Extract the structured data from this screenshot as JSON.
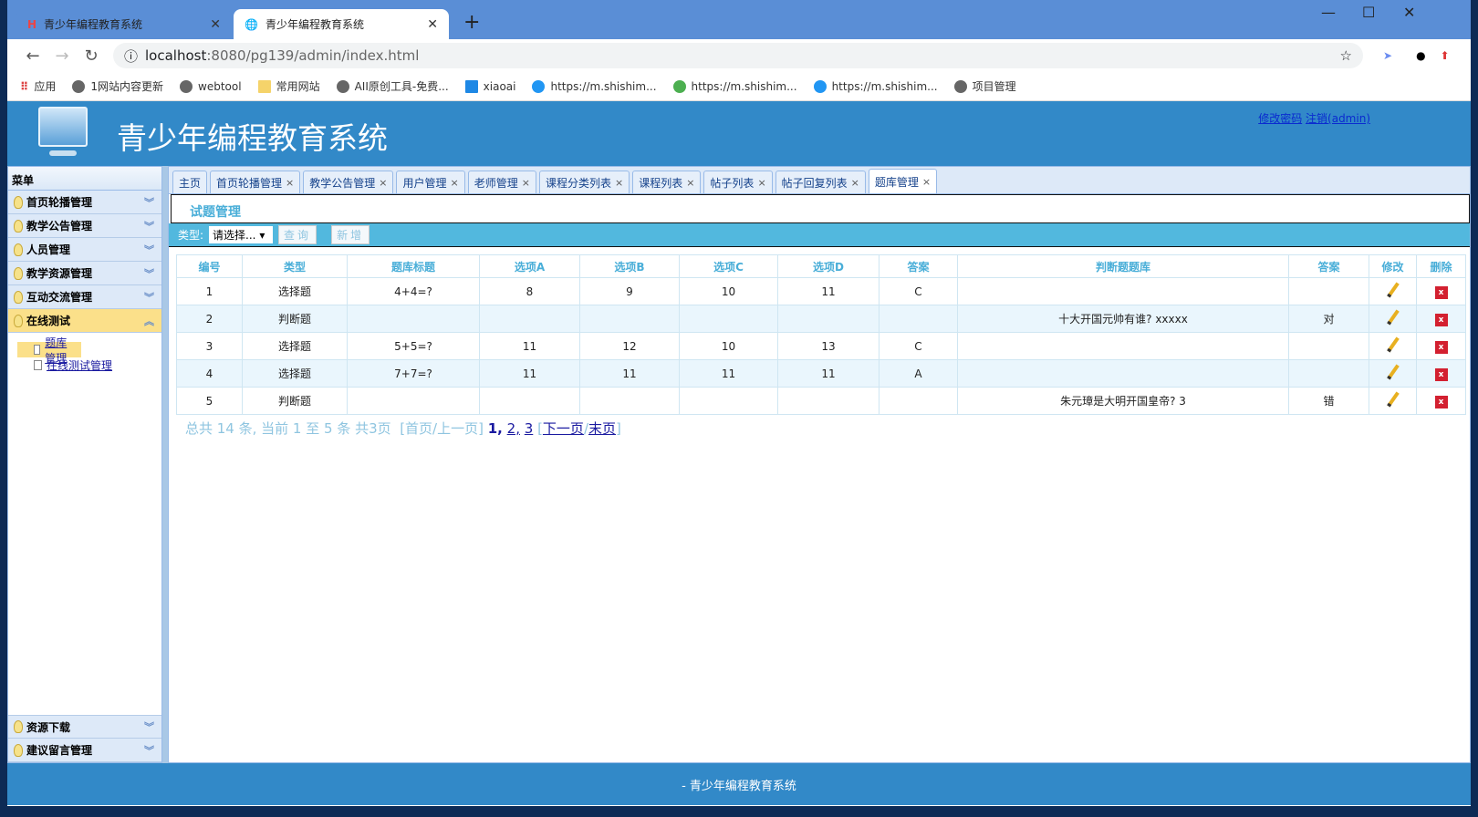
{
  "browser": {
    "tabs": [
      {
        "title": "青少年编程教育系统"
      },
      {
        "title": "青少年编程教育系统"
      }
    ],
    "url_host": "localhost",
    "url_rest": ":8080/pg139/admin/index.html",
    "bookmarks": [
      "应用",
      "1网站内容更新",
      "webtool",
      "常用网站",
      "AII原创工具-免费...",
      "xiaoai",
      "https://m.shishim...",
      "https://m.shishim...",
      "https://m.shishim...",
      "项目管理"
    ]
  },
  "header": {
    "title": "青少年编程教育系统",
    "change_password": "修改密码",
    "logout": "注销(admin)"
  },
  "sidebar": {
    "title": "菜单",
    "groups": [
      "首页轮播管理",
      "教学公告管理",
      "人员管理",
      "教学资源管理",
      "互动交流管理",
      "在线测试"
    ],
    "open_items": [
      "题库管理",
      "在线测试管理"
    ],
    "bottom_groups": [
      "资源下载",
      "建议留言管理"
    ]
  },
  "tabs": [
    "主页",
    "首页轮播管理",
    "教学公告管理",
    "用户管理",
    "老师管理",
    "课程分类列表",
    "课程列表",
    "帖子列表",
    "帖子回复列表",
    "题库管理"
  ],
  "page": {
    "title": "试题管理",
    "type_label": "类型:",
    "type_select": "请选择...",
    "query": "查询",
    "add": "新增"
  },
  "table": {
    "headers": [
      "编号",
      "类型",
      "题库标题",
      "选项A",
      "选项B",
      "选项C",
      "选项D",
      "答案",
      "判断题题库",
      "答案",
      "修改",
      "删除"
    ],
    "rows": [
      [
        "1",
        "选择题",
        "4+4=?",
        "8",
        "9",
        "10",
        "11",
        "C",
        "",
        ""
      ],
      [
        "2",
        "判断题",
        "",
        "",
        "",
        "",
        "",
        "",
        "十大开国元帅有谁? xxxxx",
        "对"
      ],
      [
        "3",
        "选择题",
        "5+5=?",
        "11",
        "12",
        "10",
        "13",
        "C",
        "",
        ""
      ],
      [
        "4",
        "选择题",
        "7+7=?",
        "11",
        "11",
        "11",
        "11",
        "A",
        "",
        ""
      ],
      [
        "5",
        "判断题",
        "",
        "",
        "",
        "",
        "",
        "",
        "朱元璋是大明开国皇帝? 3",
        "错"
      ]
    ]
  },
  "pager": {
    "summary": "总共 14 条, 当前 1 至 5 条 共3页",
    "first_prev": "[首页/上一页]",
    "p1": "1,",
    "p2": "2,",
    "p3": "3",
    "next": "下一页",
    "last": "末页"
  },
  "footer": {
    "text": "- 青少年编程教育系统"
  }
}
